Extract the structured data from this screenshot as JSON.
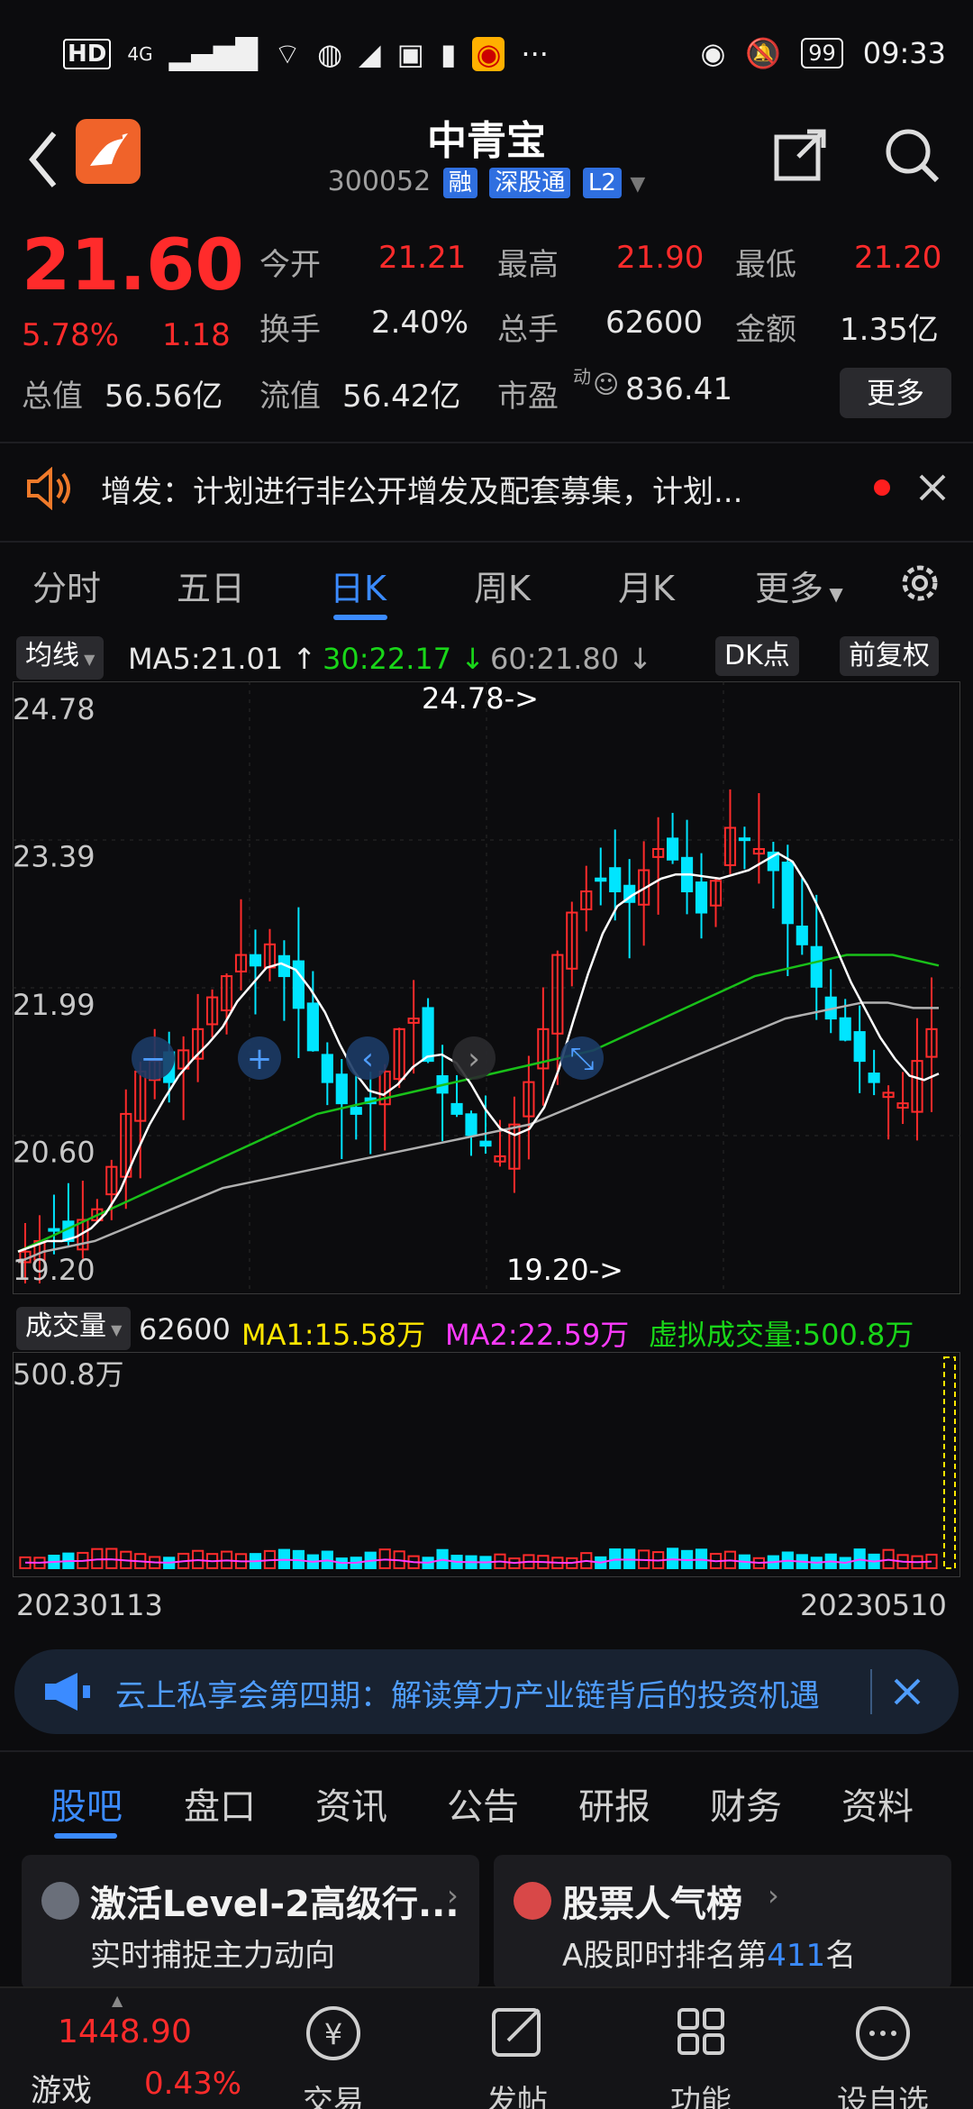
{
  "status_bar": {
    "left_text": "HD",
    "network": "4G",
    "battery": "99",
    "time": "09:33"
  },
  "header": {
    "title": "中青宝",
    "code": "300052",
    "tags": [
      "融",
      "深股通",
      "L2"
    ]
  },
  "quote": {
    "price": "21.60",
    "change_pct": "5.78%",
    "change": "1.18",
    "open_label": "今开",
    "open": "21.21",
    "high_label": "最高",
    "high": "21.90",
    "low_label": "最低",
    "low": "21.20",
    "turnover_label": "换手",
    "turnover": "2.40%",
    "volume_label": "总手",
    "volume": "62600",
    "amount_label": "金额",
    "amount": "1.35亿",
    "mktcap_label": "总值",
    "mktcap": "56.56亿",
    "float_label": "流值",
    "float": "56.42亿",
    "pe_label": "市盈",
    "pe_sup": "动",
    "pe": "836.41",
    "more_label": "更多"
  },
  "notice": {
    "text": "增发：计划进行非公开增发及配套募集，计划..."
  },
  "chart_tabs": [
    "分时",
    "五日",
    "日K",
    "周K",
    "月K",
    "更多"
  ],
  "active_tab": "日K",
  "ma_row": {
    "selector": "均线",
    "ma5": "MA5:21.01",
    "ma30": "30:22.17",
    "ma60": "60:21.80",
    "dk": "DK点",
    "adjust": "前复权"
  },
  "volume_row": {
    "selector": "成交量",
    "vol": "62600",
    "ma1": "MA1:15.58万",
    "ma2": "MA2:22.59万",
    "virtual": "虚拟成交量:500.8万"
  },
  "chart_data": {
    "type": "candlestick",
    "y_ticks": [
      "24.78",
      "23.39",
      "21.99",
      "20.60",
      "19.20"
    ],
    "ylim": [
      19.2,
      24.78
    ],
    "max_annotation": "24.78->",
    "min_annotation": "19.20->",
    "volume_axis_label": "500.8万",
    "x_start": "20230113",
    "x_end": "20230510",
    "close_path": [
      19.5,
      19.6,
      19.7,
      19.6,
      19.8,
      19.9,
      20.3,
      20.8,
      21.2,
      21.3,
      21.1,
      21.4,
      21.6,
      21.9,
      22.1,
      22.3,
      22.2,
      22.4,
      22.1,
      21.8,
      21.4,
      21.1,
      20.9,
      20.8,
      20.9,
      21.2,
      21.6,
      21.7,
      21.3,
      21.0,
      20.8,
      20.6,
      20.5,
      20.4,
      20.7,
      21.1,
      21.6,
      22.3,
      22.7,
      22.9,
      23.0,
      22.9,
      22.8,
      23.1,
      23.3,
      23.2,
      22.9,
      22.7,
      23.0,
      23.5,
      23.4,
      23.3,
      23.1,
      22.6,
      22.4,
      22.0,
      21.7,
      21.5,
      21.3,
      21.1,
      21.0,
      20.9,
      21.3,
      21.6
    ],
    "ma30_series": [
      19.5,
      19.6,
      19.7,
      19.8,
      19.9,
      20.0,
      20.1,
      20.2,
      20.3,
      20.4,
      20.5,
      20.6,
      20.7,
      20.8,
      20.85,
      20.9,
      20.95,
      21.0,
      21.05,
      21.1,
      21.15,
      21.2,
      21.25,
      21.3,
      21.35,
      21.4,
      21.5,
      21.6,
      21.7,
      21.8,
      21.9,
      22.0,
      22.1,
      22.15,
      22.2,
      22.25,
      22.3,
      22.3,
      22.3,
      22.25,
      22.2
    ],
    "ma60_series": [
      19.4,
      19.5,
      19.55,
      19.6,
      19.7,
      19.8,
      19.9,
      20.0,
      20.1,
      20.15,
      20.2,
      20.25,
      20.3,
      20.35,
      20.4,
      20.45,
      20.5,
      20.55,
      20.6,
      20.65,
      20.7,
      20.8,
      20.9,
      21.0,
      21.1,
      21.2,
      21.3,
      21.4,
      21.5,
      21.6,
      21.7,
      21.75,
      21.8,
      21.85,
      21.85,
      21.8,
      21.8
    ],
    "grid": true
  },
  "chart_controls": [
    "zoom-out",
    "zoom-in",
    "prev",
    "next",
    "fullscreen"
  ],
  "promo": {
    "text": "云上私享会第四期：解读算力产业链背后的投资机遇"
  },
  "bottom_tabs": [
    "股吧",
    "盘口",
    "资讯",
    "公告",
    "研报",
    "财务",
    "资料"
  ],
  "cards": [
    {
      "title": "激活Level-2高级行...",
      "sub": "实时捕捉主力动向"
    },
    {
      "title": "股票人气榜",
      "sub_prefix": "A股即时排名第",
      "rank": "411",
      "sub_suffix": "名"
    }
  ],
  "bottom_nav": {
    "index_value": "1448.90",
    "index_name": "游戏",
    "index_change": "0.43%",
    "items": [
      "交易",
      "发帖",
      "功能",
      "设自选"
    ]
  }
}
